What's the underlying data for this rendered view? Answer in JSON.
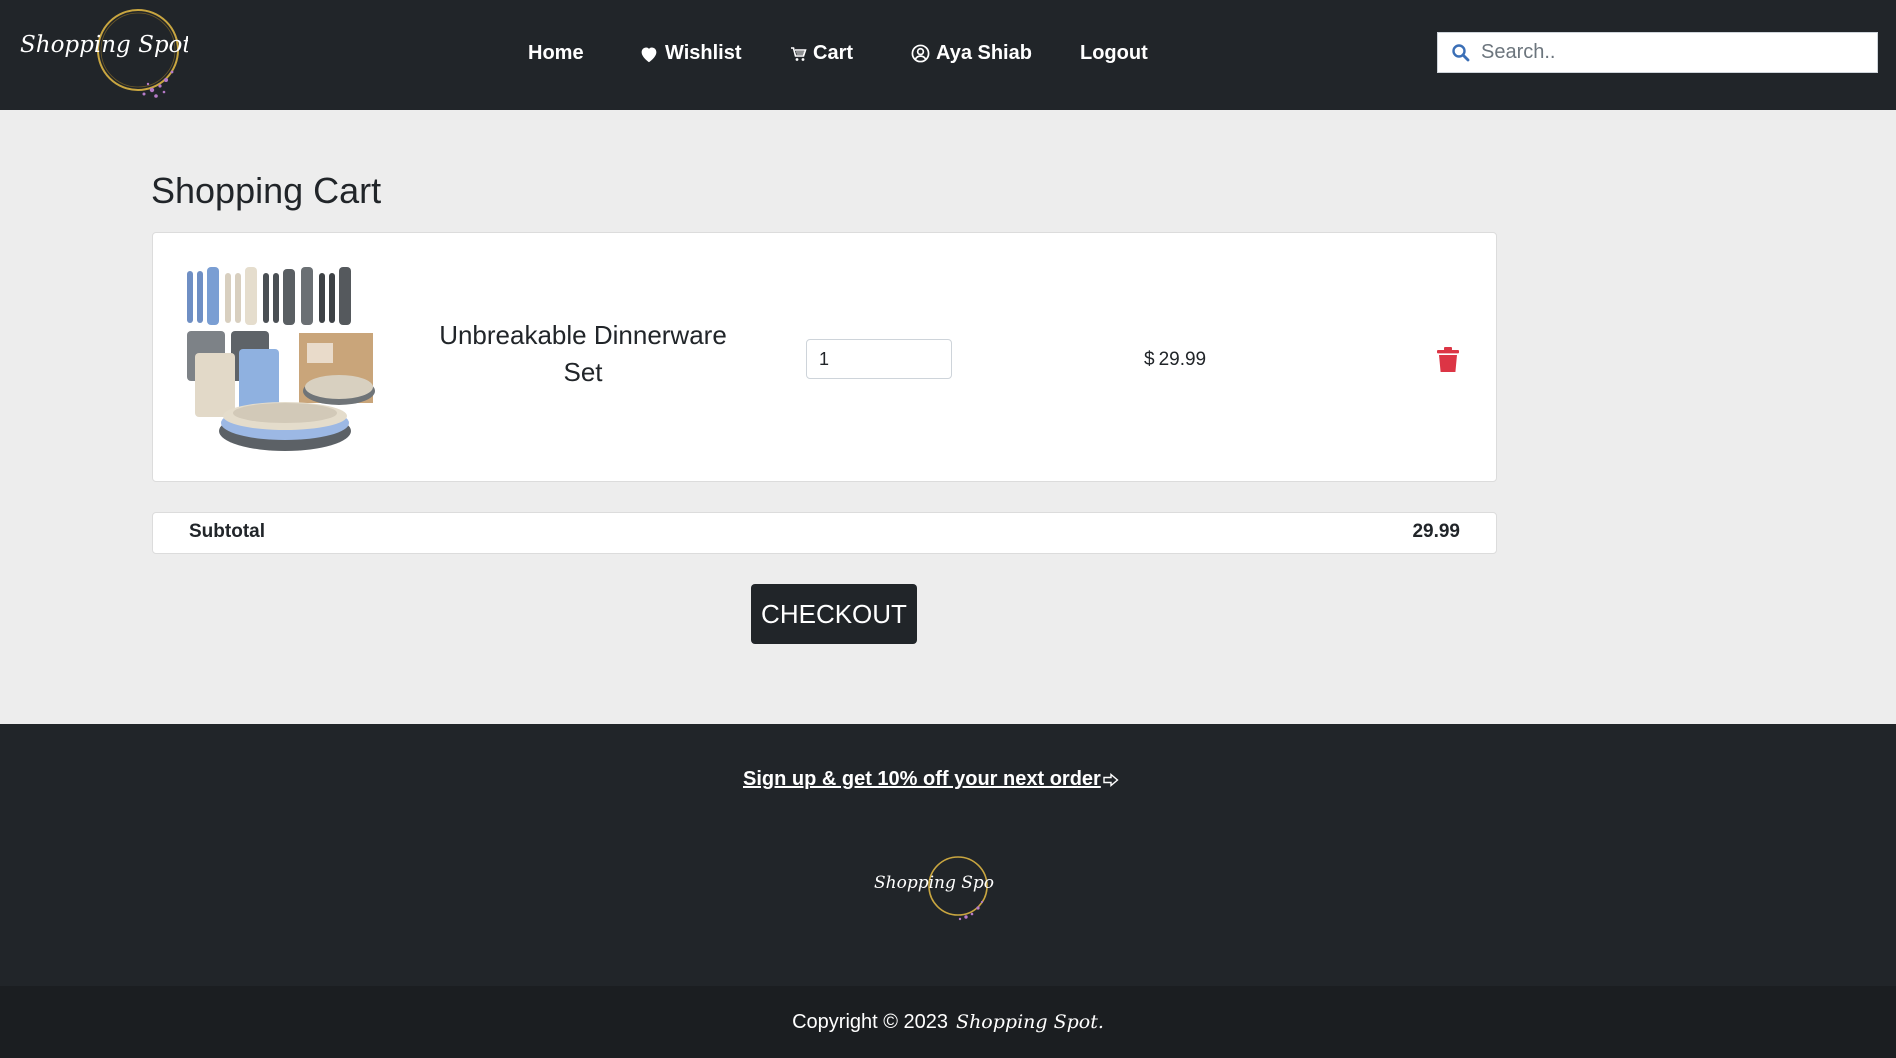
{
  "header": {
    "logo_text": "Shopping Spot",
    "nav": {
      "home": "Home",
      "wishlist": "Wishlist",
      "cart": "Cart",
      "user": "Aya Shiab",
      "logout": "Logout"
    },
    "search": {
      "placeholder": "Search..",
      "value": ""
    }
  },
  "main": {
    "title": "Shopping Cart",
    "cart_items": [
      {
        "name": "Unbreakable Dinnerware Set",
        "quantity": "1",
        "currency": "$",
        "price": "29.99"
      }
    ],
    "subtotal_label": "Subtotal",
    "subtotal_value": "29.99",
    "checkout_label": "CHECKOUT"
  },
  "footer": {
    "signup_text": "Sign up & get 10% off your next order",
    "logo_text": "Shopping Spot",
    "copyright": "Copyright © 2023",
    "copyright_brand": "Shopping Spot."
  },
  "colors": {
    "navbar": "#212529",
    "background": "#ededed",
    "danger": "#dc3545",
    "search_icon": "#3b6fb6"
  },
  "icons": [
    "heart-icon",
    "cart-icon",
    "user-circle-icon",
    "search-icon",
    "trash-icon",
    "arrow-right-icon"
  ]
}
